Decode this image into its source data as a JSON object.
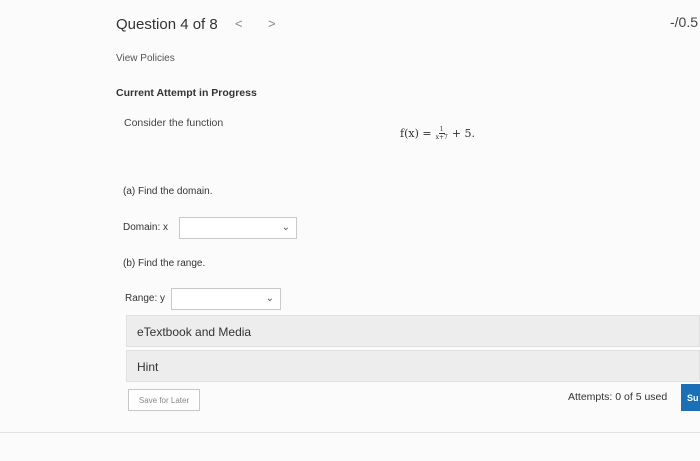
{
  "header": {
    "question_label": "Question 4 of 8",
    "prev_icon": "chevron-left-icon",
    "next_icon": "chevron-right-icon",
    "prev_glyph": "<",
    "next_glyph": ">",
    "score": "-/0.5"
  },
  "links": {
    "view_policies": "View Policies"
  },
  "attempt_status": "Current Attempt in Progress",
  "problem": {
    "intro": "Consider the function",
    "formula": {
      "lhs": "f(x) =",
      "numerator": "1",
      "denominator": "x+7",
      "rhs": "+ 5."
    }
  },
  "part_a": {
    "prompt": "(a) Find the domain.",
    "label": "Domain: x",
    "value": ""
  },
  "part_b": {
    "prompt": "(b) Find the range.",
    "label": "Range: y",
    "value": ""
  },
  "resources": {
    "etextbook": "eTextbook and Media",
    "hint": "Hint"
  },
  "footer": {
    "save_label": "Save for Later",
    "attempts": "Attempts: 0 of 5 used",
    "submit_label": "Su"
  },
  "colors": {
    "submit_blue": "#1a6fb5",
    "bar_gray": "#ededed"
  }
}
